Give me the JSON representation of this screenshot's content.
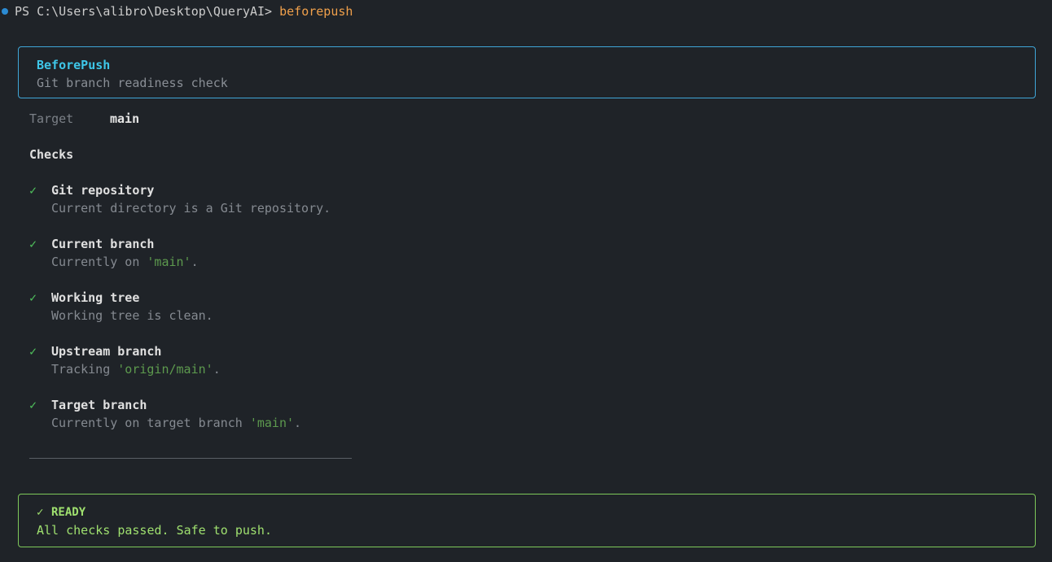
{
  "terminal": {
    "prompt": "PS C:\\Users\\alibro\\Desktop\\QueryAI> ",
    "command": "beforepush"
  },
  "header": {
    "title": "BeforePush",
    "subtitle": "Git branch readiness check"
  },
  "target": {
    "label": "Target",
    "value": "main"
  },
  "checks_heading": "Checks",
  "checks": [
    {
      "icon": "check-icon",
      "symbol": "✓",
      "title": "Git repository",
      "desc_prefix": "Current directory is a Git repository.",
      "desc_highlight": "",
      "desc_suffix": ""
    },
    {
      "icon": "check-icon",
      "symbol": "✓",
      "title": "Current branch",
      "desc_prefix": "Currently on ",
      "desc_highlight": "'main'",
      "desc_suffix": "."
    },
    {
      "icon": "check-icon",
      "symbol": "✓",
      "title": "Working tree",
      "desc_prefix": "Working tree is clean.",
      "desc_highlight": "",
      "desc_suffix": ""
    },
    {
      "icon": "check-icon",
      "symbol": "✓",
      "title": "Upstream branch",
      "desc_prefix": "Tracking ",
      "desc_highlight": "'origin/main'",
      "desc_suffix": "."
    },
    {
      "icon": "check-icon",
      "symbol": "✓",
      "title": "Target branch",
      "desc_prefix": "Currently on target branch ",
      "desc_highlight": "'main'",
      "desc_suffix": "."
    }
  ],
  "status": {
    "icon": "check-icon",
    "symbol": "✓",
    "title": "READY",
    "message": "All checks passed. Safe to push."
  },
  "colors": {
    "background": "#1f2328",
    "accent_blue": "#3ec6e8",
    "success_green": "#4fc05c",
    "status_green": "#9fe06f",
    "highlight_green": "#5d9a4e",
    "command_orange": "#f0a04b"
  }
}
